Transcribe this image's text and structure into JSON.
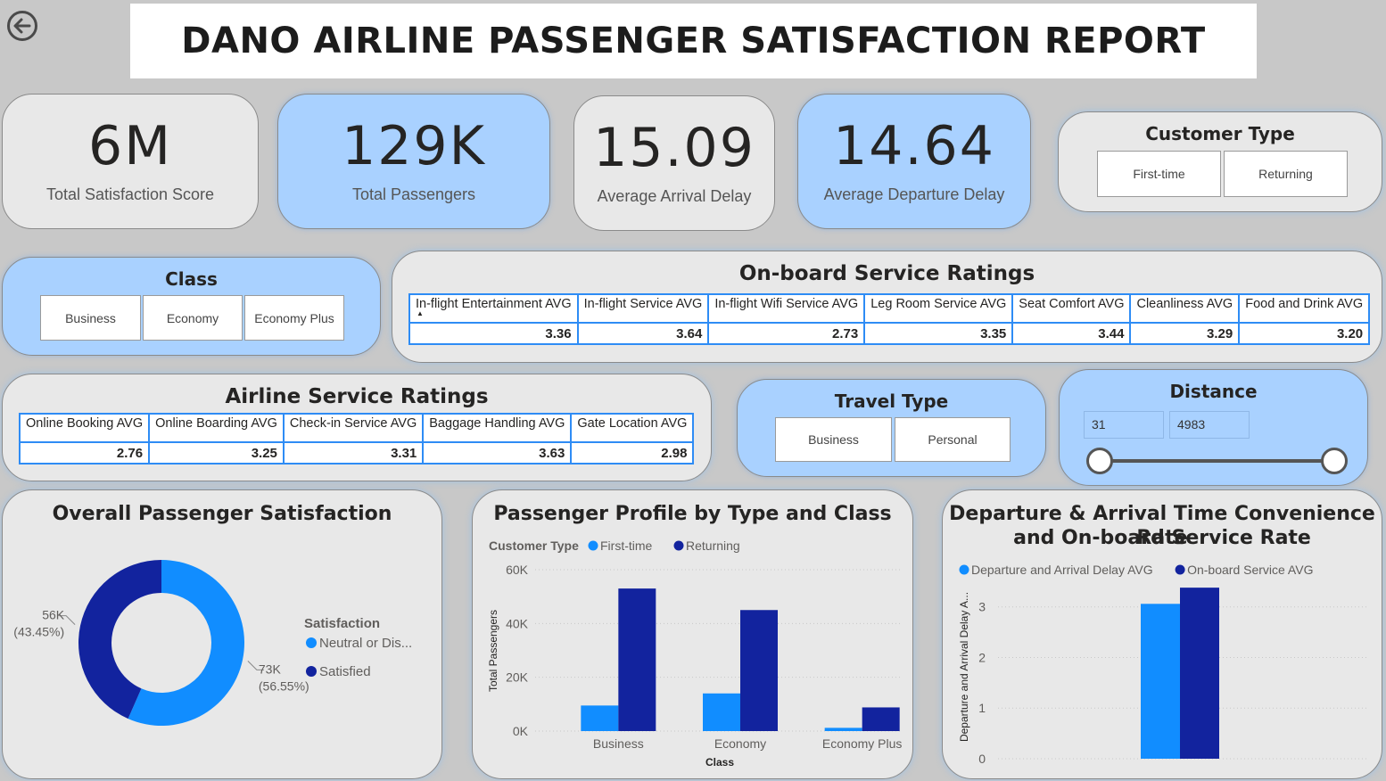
{
  "header": {
    "title": "DANO AIRLINE PASSENGER SATISFACTION REPORT"
  },
  "kpis": [
    {
      "value": "6M",
      "label": "Total Satisfaction Score"
    },
    {
      "value": "129K",
      "label": "Total Passengers"
    },
    {
      "value": "15.09",
      "label": "Average Arrival Delay"
    },
    {
      "value": "14.64",
      "label": "Average Departure Delay"
    }
  ],
  "customer_type": {
    "title": "Customer Type",
    "options": [
      "First-time",
      "Returning"
    ]
  },
  "class_slicer": {
    "title": "Class",
    "options": [
      "Business",
      "Economy",
      "Economy Plus"
    ]
  },
  "onboard": {
    "title": "On-board Service Ratings",
    "headers": [
      "In-flight Entertainment AVG",
      "In-flight Service AVG",
      "In-flight Wifi Service AVG",
      "Leg Room Service AVG",
      "Seat Comfort AVG",
      "Cleanliness AVG",
      "Food and Drink AVG"
    ],
    "values": [
      "3.36",
      "3.64",
      "2.73",
      "3.35",
      "3.44",
      "3.29",
      "3.20"
    ]
  },
  "airline": {
    "title": "Airline Service Ratings",
    "headers": [
      "Online Booking AVG",
      "Online Boarding AVG",
      "Check-in Service AVG",
      "Baggage Handling AVG",
      "Gate Location AVG"
    ],
    "values": [
      "2.76",
      "3.25",
      "3.31",
      "3.63",
      "2.98"
    ]
  },
  "travel_type": {
    "title": "Travel Type",
    "options": [
      "Business",
      "Personal"
    ]
  },
  "distance": {
    "title": "Distance",
    "min": "31",
    "max": "4983"
  },
  "colors": {
    "light_blue": "#118dff",
    "dark_blue": "#12239e",
    "panel_blue": "#a9d1ff",
    "table_border": "#2e8cf5"
  },
  "chart_data": [
    {
      "type": "donut",
      "title": "Overall Passenger Satisfaction",
      "legend_title": "Satisfaction",
      "legend_position": "right",
      "slices": [
        {
          "name": "Neutral or Dis...",
          "value": 73,
          "label": "73K",
          "percent": "(56.55%)",
          "color": "#118dff"
        },
        {
          "name": "Satisfied",
          "value": 56,
          "label": "56K",
          "percent": "(43.45%)",
          "color": "#12239e"
        }
      ]
    },
    {
      "type": "bar",
      "title": "Passenger Profile by Type and Class",
      "legend_title": "Customer Type",
      "legend_position": "top-left",
      "categories": [
        "Business",
        "Economy",
        "Economy Plus"
      ],
      "series": [
        {
          "name": "First-time",
          "values": [
            9.5,
            14,
            1.2
          ],
          "color": "#118dff"
        },
        {
          "name": "Returning",
          "values": [
            53,
            45,
            8.8
          ],
          "color": "#12239e"
        }
      ],
      "unit": "K",
      "xlabel": "Class",
      "ylabel": "Total Passengers",
      "ylim": [
        0,
        60
      ],
      "yticks": [
        "0K",
        "20K",
        "40K",
        "60K"
      ],
      "grid": true
    },
    {
      "type": "bar",
      "title_lines": [
        "Departure & Arrival Time Convenience Rate",
        "and On-board Service Rate"
      ],
      "legend_position": "top-left",
      "series": [
        {
          "name": "Departure and Arrival Delay AVG",
          "values": [
            3.06
          ],
          "color": "#118dff"
        },
        {
          "name": "On-board Service AVG",
          "values": [
            3.38
          ],
          "color": "#12239e"
        }
      ],
      "ylabel": "Departure and Arrival Delay A...",
      "ylim": [
        0,
        3.4
      ],
      "yticks": [
        "0",
        "1",
        "2",
        "3"
      ],
      "grid": true
    }
  ]
}
